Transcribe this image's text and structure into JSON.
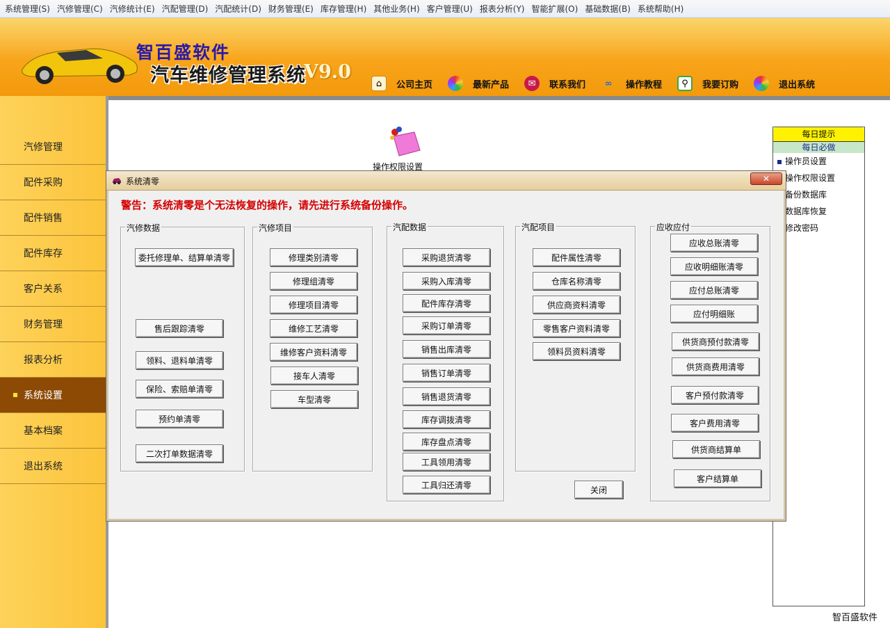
{
  "menu": [
    "系统管理(S)",
    "汽修管理(C)",
    "汽修统计(E)",
    "汽配管理(D)",
    "汽配统计(D)",
    "财务管理(E)",
    "库存管理(H)",
    "其他业务(H)",
    "客户管理(U)",
    "报表分析(Y)",
    "智能扩展(O)",
    "基础数据(B)",
    "系统帮助(H)"
  ],
  "header": {
    "brand": "智百盛软件",
    "product": "汽车维修管理系统",
    "version": "V9.0",
    "links": [
      "公司主页",
      "最新产品",
      "联系我们",
      "操作教程",
      "我要订购",
      "退出系统"
    ]
  },
  "sidebar": [
    "汽修管理",
    "配件采购",
    "配件销售",
    "配件库存",
    "客户关系",
    "财务管理",
    "报表分析",
    "系统设置",
    "基本档案",
    "退出系统"
  ],
  "sidebar_active": "系统设置",
  "desktop_icon_label": "操作权限设置",
  "tips": {
    "title": "每日提示",
    "subtitle": "每日必做",
    "items": [
      "操作员设置",
      "操作权限设置",
      "备份数据库",
      "数据库恢复",
      "修改密码"
    ]
  },
  "footer_brand": "智百盛软件",
  "dialog": {
    "title": "系统清零",
    "close_symbol": "✕",
    "warning": "警告：系统清零是个无法恢复的操作，请先进行系统备份操作。",
    "close_label": "关闭",
    "groups": [
      {
        "label": "汽修数据",
        "buttons": [
          "委托修理单、结算单清零",
          "售后跟踪清零",
          "领料、退料单清零",
          "保险、索赔单清零",
          "预约单清零",
          "二次打单数据清零"
        ]
      },
      {
        "label": "汽修项目",
        "buttons": [
          "修理类别清零",
          "修理组清零",
          "修理项目清零",
          "维修工艺清零",
          "维修客户资料清零",
          "接车人清零",
          "车型清零"
        ]
      },
      {
        "label": "汽配数据",
        "buttons": [
          "采购退货清零",
          "采购入库清零",
          "配件库存清零",
          "采购订单清零",
          "销售出库清零",
          "销售订单清零",
          "销售退货清零",
          "库存调拨清零",
          "库存盘点清零",
          "工具领用清零",
          "工具归还清零"
        ]
      },
      {
        "label": "汽配项目",
        "buttons": [
          "配件属性清零",
          "仓库名称清零",
          "供应商资料清零",
          "零售客户资料清零",
          "领料员资料清零"
        ]
      },
      {
        "label": "应收应付",
        "buttons": [
          "应收总账清零",
          "应收明细账清零",
          "应付总账清零",
          "应付明细账",
          "供货商预付款清零",
          "供货商费用清零",
          "客户预付款清零",
          "客户费用清零",
          "供货商结算单",
          "客户结算单"
        ]
      }
    ]
  }
}
